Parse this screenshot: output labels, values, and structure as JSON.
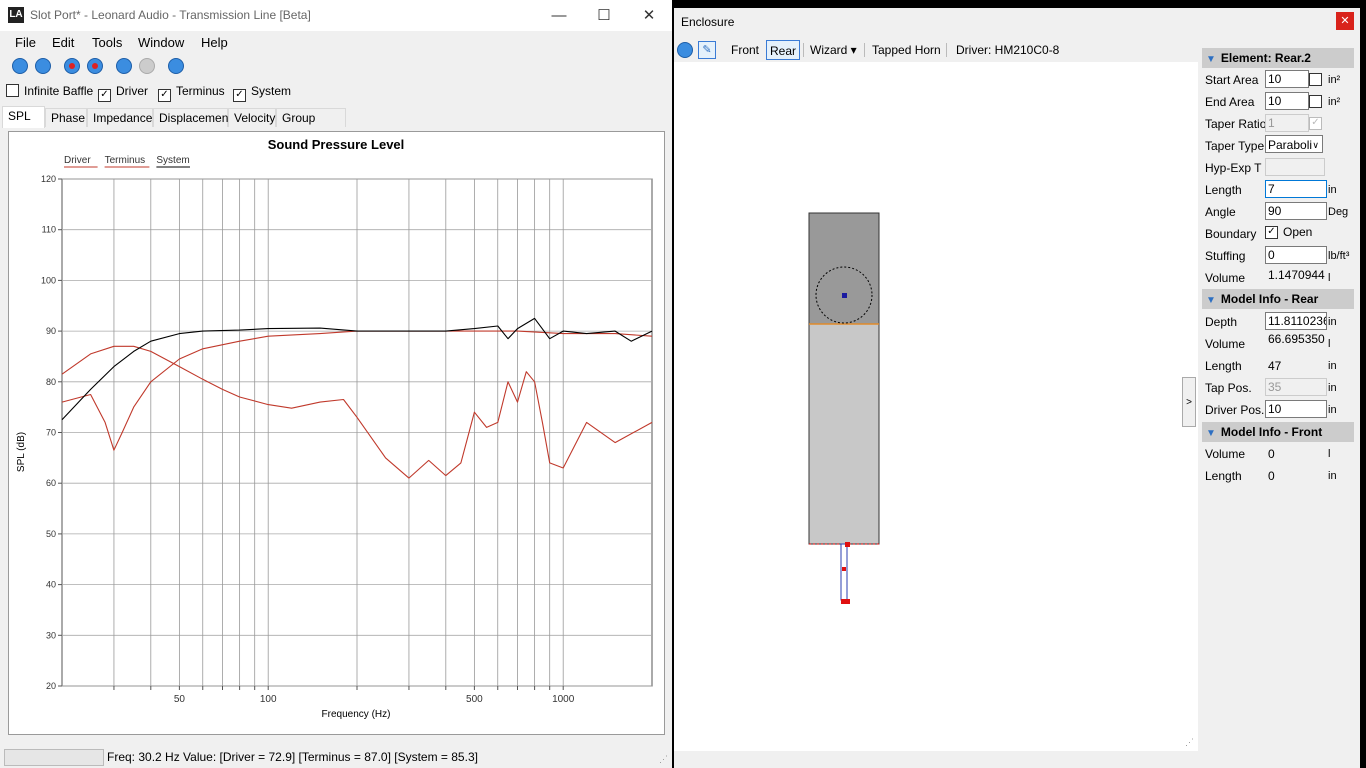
{
  "main_window": {
    "title": "Slot Port* - Leonard Audio - Transmission Line [Beta]",
    "app_icon_text": "LA",
    "controls": {
      "minimize": "—",
      "maximize": "☐",
      "close": "✕"
    }
  },
  "menu": {
    "items": [
      "File",
      "Edit",
      "Tools",
      "Window",
      "Help"
    ]
  },
  "toolbar_icons": [
    "new-file-icon",
    "open-file-icon",
    "record-icon",
    "record-stop-icon",
    "step-back-icon",
    "step-forward-icon",
    "play-icon"
  ],
  "checkboxes": [
    {
      "label": "Infinite Baffle",
      "checked": false
    },
    {
      "label": "Driver",
      "checked": true
    },
    {
      "label": "Terminus",
      "checked": true
    },
    {
      "label": "System",
      "checked": true
    }
  ],
  "tabs": [
    {
      "label": "SPL",
      "active": true
    },
    {
      "label": "Phase",
      "active": false
    },
    {
      "label": "Impedance",
      "active": false
    },
    {
      "label": "Displacement",
      "active": false
    },
    {
      "label": "Velocity",
      "active": false
    },
    {
      "label": "Group Delay",
      "active": false
    }
  ],
  "chart_data": {
    "type": "line",
    "title": "Sound Pressure Level",
    "xlabel": "Frequency (Hz)",
    "ylabel": "SPL (dB)",
    "xscale": "log",
    "xlim": [
      20,
      2000
    ],
    "ylim": [
      20,
      120
    ],
    "yticks": [
      20,
      30,
      40,
      50,
      60,
      70,
      80,
      90,
      100,
      110,
      120
    ],
    "xtick_labels": [
      50,
      100,
      500,
      1000
    ],
    "grid": true,
    "legend": [
      "Driver",
      "Terminus",
      "System"
    ],
    "legend_placement": "top-left",
    "series": [
      {
        "name": "Driver",
        "color": "#c0392b",
        "x": [
          20,
          25,
          30,
          35,
          40,
          50,
          60,
          70,
          80,
          100,
          120,
          150,
          180,
          200,
          250,
          300,
          350,
          400,
          450,
          500,
          550,
          600,
          650,
          700,
          750,
          800,
          850,
          900,
          1000,
          1200,
          1500,
          2000
        ],
        "y": [
          81.5,
          85.5,
          87.0,
          87.0,
          86.0,
          83.0,
          80.5,
          78.5,
          77.0,
          75.5,
          74.8,
          76.0,
          76.5,
          73.0,
          65.0,
          61.0,
          64.5,
          61.5,
          64.0,
          74.0,
          71.0,
          72.0,
          80.0,
          76.0,
          82.0,
          80.0,
          72.0,
          64.0,
          63.0,
          72.0,
          68.0,
          72.0
        ]
      },
      {
        "name": "Terminus",
        "color": "#c0392b",
        "x": [
          20,
          25,
          28,
          30,
          32,
          35,
          40,
          50,
          60,
          80,
          100,
          150,
          200,
          300,
          500,
          700,
          1000,
          1500,
          2000
        ],
        "y": [
          76.0,
          77.5,
          72.0,
          66.5,
          70.0,
          75.0,
          80.0,
          84.5,
          86.5,
          88.0,
          89.0,
          89.5,
          90.0,
          90.0,
          90.0,
          90.0,
          89.5,
          89.5,
          89.0
        ]
      },
      {
        "name": "System",
        "color": "#000000",
        "x": [
          20,
          25,
          30,
          35,
          40,
          50,
          60,
          80,
          100,
          150,
          200,
          300,
          400,
          500,
          600,
          650,
          700,
          800,
          900,
          1000,
          1200,
          1500,
          1700,
          2000
        ],
        "y": [
          72.5,
          78.5,
          83.0,
          86.0,
          88.0,
          89.5,
          90.0,
          90.2,
          90.5,
          90.6,
          90.0,
          90.0,
          90.0,
          90.5,
          91.0,
          88.5,
          90.5,
          92.5,
          88.5,
          90.0,
          89.5,
          90.0,
          88.0,
          90.0
        ]
      }
    ]
  },
  "status": {
    "text": "Freq: 30.2 Hz  Value: [Driver = 72.9]  [Terminus = 87.0]  [System = 85.3]"
  },
  "enclosure_window": {
    "title": "Enclosure",
    "close": "✕",
    "toolbar": {
      "front": "Front",
      "rear": "Rear",
      "wizard": "Wizard ▾",
      "tapped_horn": "Tapped Horn",
      "driver": "Driver: HM210C0-8"
    },
    "splitter_label": ">"
  },
  "properties": {
    "element_header": "Element: Rear.2",
    "start_area": {
      "label": "Start Area",
      "value": "10",
      "unit": "in²"
    },
    "end_area": {
      "label": "End Area",
      "value": "10",
      "unit": "in²"
    },
    "taper_ratio": {
      "label": "Taper Ratio",
      "value": "1"
    },
    "taper_type": {
      "label": "Taper Type",
      "value": "Paraboli"
    },
    "hyp_exp": {
      "label": "Hyp-Exp T",
      "value": ""
    },
    "length": {
      "label": "Length",
      "value": "7",
      "unit": "in"
    },
    "angle": {
      "label": "Angle",
      "value": "90",
      "unit": "Deg"
    },
    "boundary": {
      "label": "Boundary",
      "option": "Open"
    },
    "stuffing": {
      "label": "Stuffing",
      "value": "0",
      "unit": "lb/ft³"
    },
    "volume": {
      "label": "Volume",
      "value": "1.1470944",
      "unit": "l"
    },
    "rear_header": "Model Info - Rear",
    "rear_depth": {
      "label": "Depth",
      "value": "11.8110236",
      "unit": "in"
    },
    "rear_volume": {
      "label": "Volume",
      "value": "66.695350",
      "unit": "l"
    },
    "rear_length": {
      "label": "Length",
      "value": "47",
      "unit": "in"
    },
    "tap_pos": {
      "label": "Tap Pos.",
      "value": "35",
      "unit": "in"
    },
    "driver_pos": {
      "label": "Driver Pos.",
      "value": "10",
      "unit": "in"
    },
    "front_header": "Model Info - Front",
    "front_volume": {
      "label": "Volume",
      "value": "0",
      "unit": "l"
    },
    "front_length": {
      "label": "Length",
      "value": "0",
      "unit": "in"
    }
  }
}
